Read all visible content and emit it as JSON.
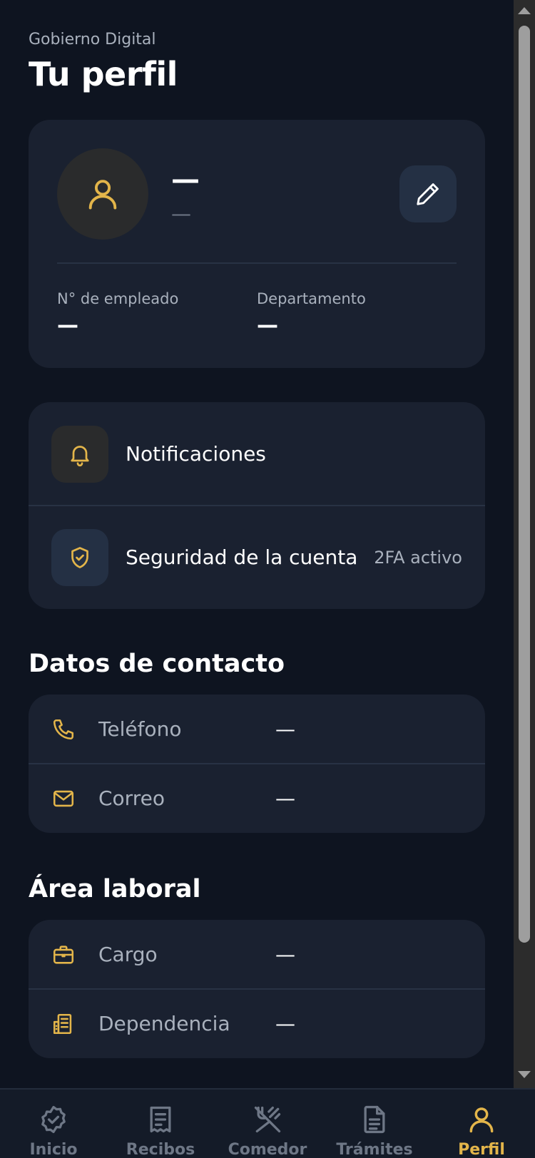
{
  "header": {
    "app_name": "Gobierno Digital",
    "title": "Tu perfil"
  },
  "profile": {
    "name": "—",
    "email": "—",
    "employee_label": "N° de empleado",
    "employee_value": "—",
    "department_label": "Departamento",
    "department_value": "—",
    "icons": {
      "avatar": "user-icon",
      "edit": "pencil-icon"
    }
  },
  "settings": [
    {
      "label": "Notificaciones",
      "icon": "bell-icon",
      "badge": ""
    },
    {
      "label": "Seguridad de la cuenta",
      "icon": "shield-check-icon",
      "badge": "2FA activo"
    }
  ],
  "contact": {
    "title": "Datos de contacto",
    "rows": [
      {
        "label": "Teléfono",
        "value": "—",
        "icon": "phone-icon"
      },
      {
        "label": "Correo",
        "value": "—",
        "icon": "mail-icon"
      }
    ]
  },
  "work": {
    "title": "Área laboral",
    "rows": [
      {
        "label": "Cargo",
        "value": "—",
        "icon": "briefcase-icon"
      },
      {
        "label": "Dependencia",
        "value": "—",
        "icon": "building-icon"
      }
    ]
  },
  "nav": {
    "items": [
      {
        "label": "Inicio",
        "icon": "check-badge-icon",
        "active": false
      },
      {
        "label": "Recibos",
        "icon": "receipt-icon",
        "active": false
      },
      {
        "label": "Comedor",
        "icon": "utensils-icon",
        "active": false
      },
      {
        "label": "Trámites",
        "icon": "document-icon",
        "active": false
      },
      {
        "label": "Perfil",
        "icon": "user-icon",
        "active": true
      }
    ]
  },
  "colors": {
    "background": "#0e1420",
    "card": "#1a2130",
    "accent": "#e3b54a",
    "muted_text": "#a9b1bd"
  }
}
